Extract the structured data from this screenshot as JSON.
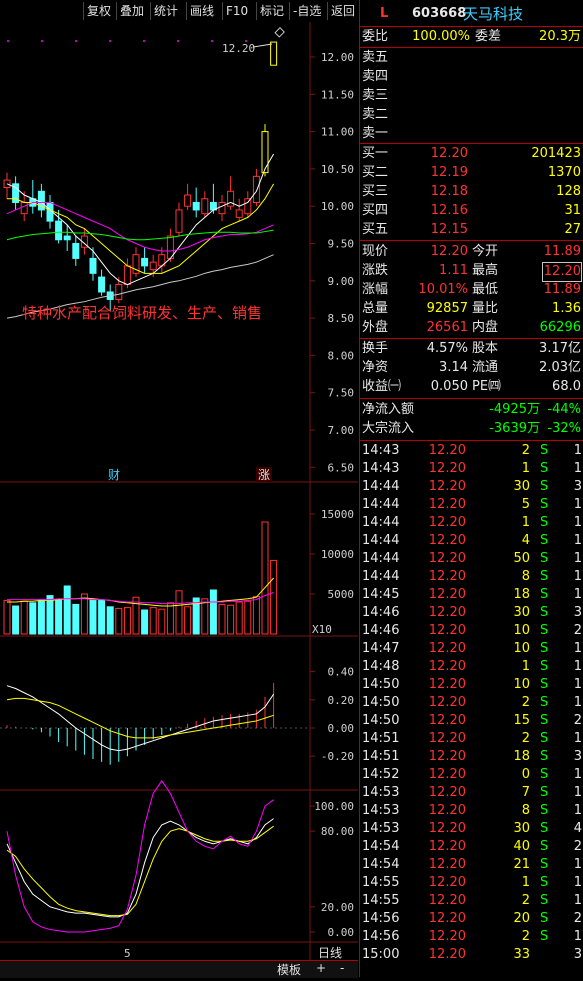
{
  "toolbar": {
    "buttons": [
      "复权",
      "叠加",
      "统计",
      "画线",
      "F10",
      "标记",
      "-自选",
      "返回"
    ]
  },
  "header": {
    "indicator": "L",
    "code": "603668",
    "name": "天马科技"
  },
  "order_book": {
    "weibi_label": "委比",
    "weibi_value": "100.00%",
    "weicha_label": "委差",
    "weicha_value": "20.3万",
    "sells": [
      {
        "label": "卖五",
        "price": "",
        "vol": ""
      },
      {
        "label": "卖四",
        "price": "",
        "vol": ""
      },
      {
        "label": "卖三",
        "price": "",
        "vol": ""
      },
      {
        "label": "卖二",
        "price": "",
        "vol": ""
      },
      {
        "label": "卖一",
        "price": "",
        "vol": ""
      }
    ],
    "buys": [
      {
        "label": "买一",
        "price": "12.20",
        "vol": "201423"
      },
      {
        "label": "买二",
        "price": "12.19",
        "vol": "1370"
      },
      {
        "label": "买三",
        "price": "12.18",
        "vol": "128"
      },
      {
        "label": "买四",
        "price": "12.16",
        "vol": "31"
      },
      {
        "label": "买五",
        "price": "12.15",
        "vol": "27"
      }
    ]
  },
  "quote": [
    {
      "l1": "现价",
      "v1": "12.20",
      "l2": "今开",
      "v2": "11.89"
    },
    {
      "l1": "涨跌",
      "v1": "1.11",
      "l2": "最高",
      "v2": "12.20"
    },
    {
      "l1": "涨幅",
      "v1": "10.01%",
      "l2": "最低",
      "v2": "11.89"
    },
    {
      "l1": "总量",
      "v1": "92857",
      "l2": "量比",
      "v2": "1.36"
    },
    {
      "l1": "外盘",
      "v1": "26561",
      "l2": "内盘",
      "v2": "66296"
    }
  ],
  "fundamentals": [
    {
      "l1": "换手",
      "v1": "4.57%",
      "l2": "股本",
      "v2": "3.17亿"
    },
    {
      "l1": "净资",
      "v1": "3.14",
      "l2": "流通",
      "v2": "2.03亿"
    },
    {
      "l1": "收益㈠",
      "v1": "0.050",
      "l2": "PE㈣",
      "v2": "68.0"
    }
  ],
  "flows": [
    {
      "label": "净流入额",
      "value": "-4925万",
      "pct": "-44%"
    },
    {
      "label": "大宗流入",
      "value": "-3639万",
      "pct": "-32%"
    }
  ],
  "ticks": [
    {
      "t": "14:43",
      "p": "12.20",
      "v": "2",
      "s": "S",
      "n": "1"
    },
    {
      "t": "14:43",
      "p": "12.20",
      "v": "1",
      "s": "S",
      "n": "1"
    },
    {
      "t": "14:44",
      "p": "12.20",
      "v": "30",
      "s": "S",
      "n": "3"
    },
    {
      "t": "14:44",
      "p": "12.20",
      "v": "5",
      "s": "S",
      "n": "1"
    },
    {
      "t": "14:44",
      "p": "12.20",
      "v": "1",
      "s": "S",
      "n": "1"
    },
    {
      "t": "14:44",
      "p": "12.20",
      "v": "4",
      "s": "S",
      "n": "1"
    },
    {
      "t": "14:44",
      "p": "12.20",
      "v": "50",
      "s": "S",
      "n": "1"
    },
    {
      "t": "14:44",
      "p": "12.20",
      "v": "8",
      "s": "S",
      "n": "1"
    },
    {
      "t": "14:45",
      "p": "12.20",
      "v": "18",
      "s": "S",
      "n": "1"
    },
    {
      "t": "14:46",
      "p": "12.20",
      "v": "30",
      "s": "S",
      "n": "3"
    },
    {
      "t": "14:46",
      "p": "12.20",
      "v": "10",
      "s": "S",
      "n": "2"
    },
    {
      "t": "14:47",
      "p": "12.20",
      "v": "10",
      "s": "S",
      "n": "1"
    },
    {
      "t": "14:48",
      "p": "12.20",
      "v": "1",
      "s": "S",
      "n": "1"
    },
    {
      "t": "14:50",
      "p": "12.20",
      "v": "10",
      "s": "S",
      "n": "1"
    },
    {
      "t": "14:50",
      "p": "12.20",
      "v": "2",
      "s": "S",
      "n": "1"
    },
    {
      "t": "14:50",
      "p": "12.20",
      "v": "15",
      "s": "S",
      "n": "2"
    },
    {
      "t": "14:51",
      "p": "12.20",
      "v": "2",
      "s": "S",
      "n": "1"
    },
    {
      "t": "14:51",
      "p": "12.20",
      "v": "18",
      "s": "S",
      "n": "3"
    },
    {
      "t": "14:52",
      "p": "12.20",
      "v": "0",
      "s": "S",
      "n": "1"
    },
    {
      "t": "14:53",
      "p": "12.20",
      "v": "7",
      "s": "S",
      "n": "1"
    },
    {
      "t": "14:53",
      "p": "12.20",
      "v": "8",
      "s": "S",
      "n": "1"
    },
    {
      "t": "14:53",
      "p": "12.20",
      "v": "30",
      "s": "S",
      "n": "4"
    },
    {
      "t": "14:54",
      "p": "12.20",
      "v": "40",
      "s": "S",
      "n": "2"
    },
    {
      "t": "14:54",
      "p": "12.20",
      "v": "21",
      "s": "S",
      "n": "1"
    },
    {
      "t": "14:55",
      "p": "12.20",
      "v": "1",
      "s": "S",
      "n": "1"
    },
    {
      "t": "14:55",
      "p": "12.20",
      "v": "2",
      "s": "S",
      "n": "1"
    },
    {
      "t": "14:56",
      "p": "12.20",
      "v": "20",
      "s": "S",
      "n": "2"
    },
    {
      "t": "14:56",
      "p": "12.20",
      "v": "2",
      "s": "S",
      "n": "1"
    },
    {
      "t": "15:00",
      "p": "12.20",
      "v": "33",
      "s": "",
      "n": "3"
    }
  ],
  "chart": {
    "price_ticks": [
      "12.00",
      "11.50",
      "11.00",
      "10.50",
      "10.00",
      "9.50",
      "9.00",
      "8.50",
      "8.00",
      "7.50",
      "7.00",
      "6.50"
    ],
    "last_price_label": "12.20",
    "annotation": "特种水产配合饲料研发、生产、销售",
    "marker_cai": "财",
    "marker_zhang": "涨",
    "vol_ticks": [
      "15000",
      "10000",
      "5000"
    ],
    "vol_unit": "X10",
    "macd_ticks": [
      "0.40",
      "0.20",
      "0.00",
      "-0.20"
    ],
    "kdj_ticks": [
      "100.00",
      "80.00",
      "20.00",
      "0.00"
    ],
    "x_label": "5",
    "period_label": "日线",
    "template_label": "模板",
    "plus_label": "+",
    "minus_label": "-"
  },
  "colors": {
    "up": "#ff3232",
    "down": "#54ffff",
    "grid": "#7a1414",
    "ma_white": "#ffffff",
    "ma_yellow": "#ffff00",
    "ma_magenta": "#ff00ff",
    "ma_green": "#00ff00"
  }
}
